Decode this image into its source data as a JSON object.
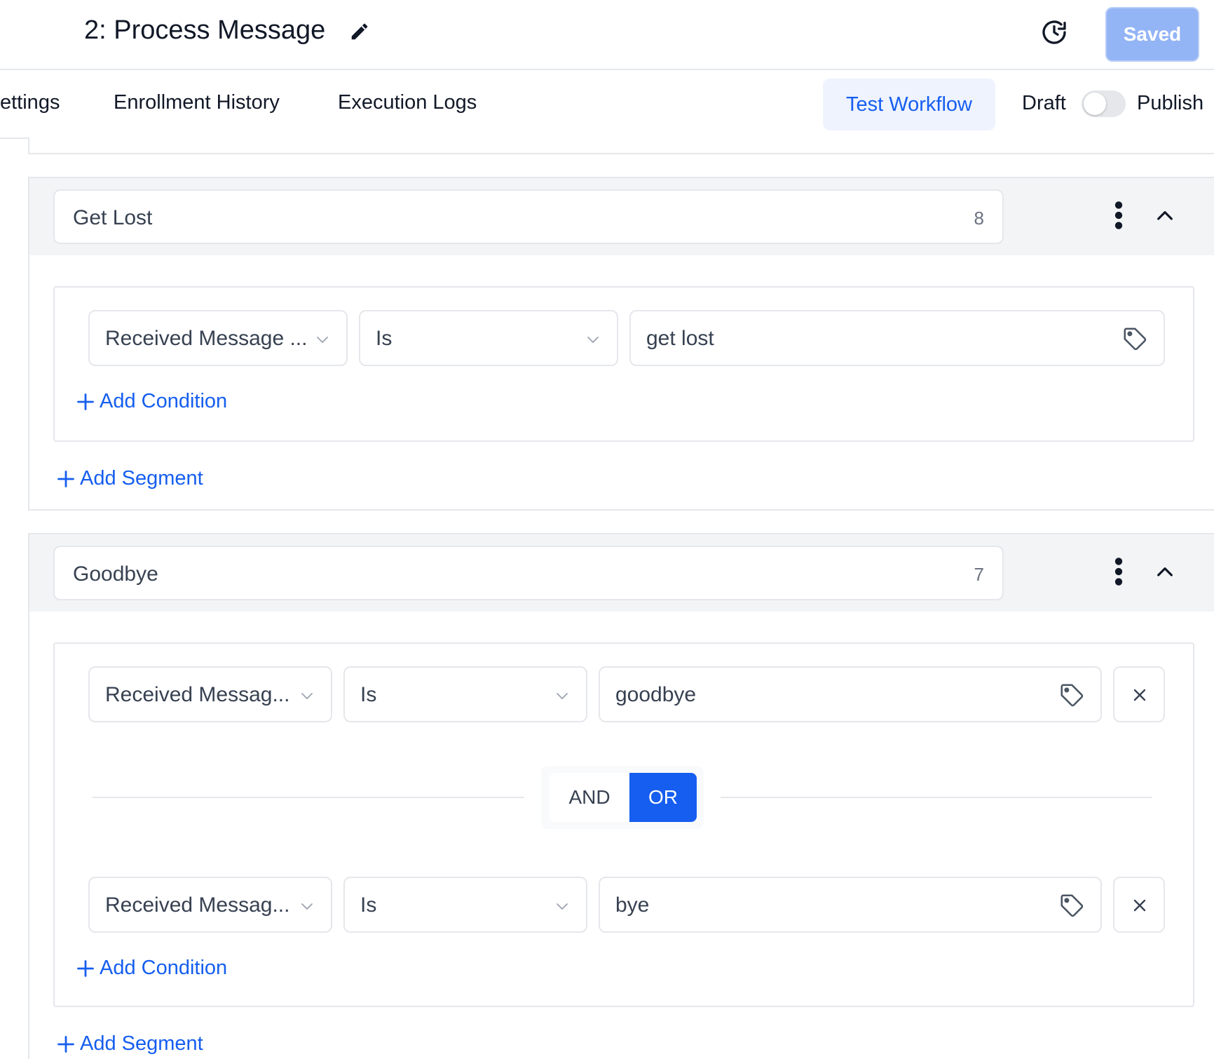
{
  "header": {
    "title": "2: Process Message",
    "saved_label": "Saved"
  },
  "tabs": {
    "settings": "ettings",
    "enrollment_history": "Enrollment History",
    "execution_logs": "Execution Logs",
    "test_workflow": "Test Workflow",
    "draft_label": "Draft",
    "publish_label": "Publish",
    "publish_enabled": false
  },
  "segments": [
    {
      "name": "Get Lost",
      "count": "8",
      "conditions": [
        {
          "field": "Received Message ...",
          "operator": "Is",
          "value": "get lost"
        }
      ],
      "add_condition": "Add Condition",
      "add_segment": "Add Segment"
    },
    {
      "name": "Goodbye",
      "count": "7",
      "conditions": [
        {
          "field": "Received Messag...",
          "operator": "Is",
          "value": "goodbye"
        },
        {
          "field": "Received Messag...",
          "operator": "Is",
          "value": "bye"
        }
      ],
      "logic": {
        "and_label": "AND",
        "or_label": "OR",
        "selected": "OR"
      },
      "add_condition": "Add Condition",
      "add_segment": "Add Segment"
    }
  ],
  "colors": {
    "accent": "#155eef",
    "saved_button": "#93b4f5",
    "segment_header_bg": "#f3f4f6",
    "border": "#e5e7eb"
  },
  "icons": [
    "edit-icon",
    "history-icon",
    "kebab-menu-icon",
    "chevron-up-icon",
    "chevron-down-icon",
    "tag-icon",
    "close-icon",
    "plus-icon"
  ]
}
